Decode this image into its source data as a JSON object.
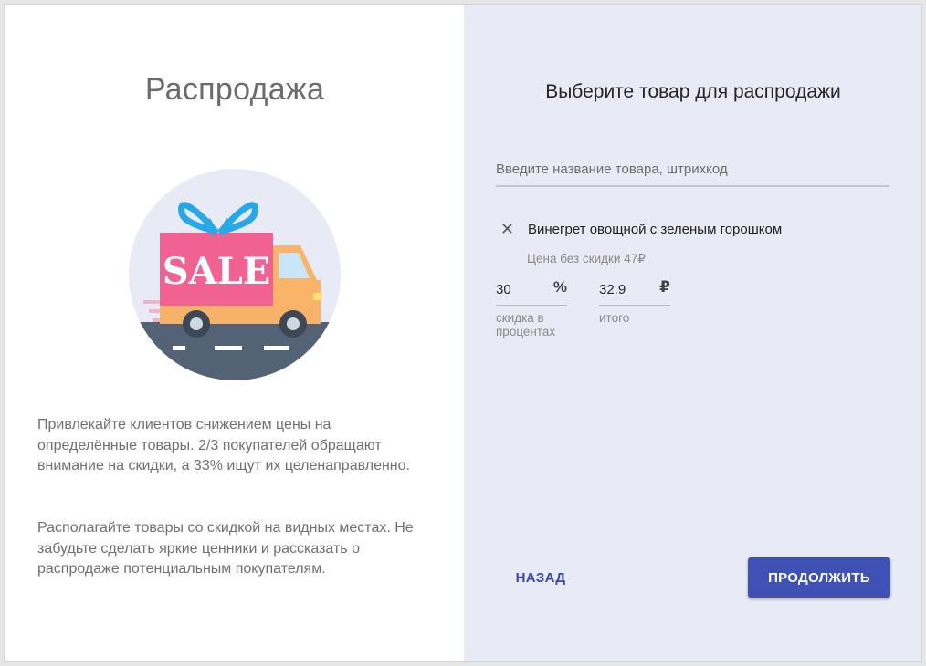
{
  "left": {
    "title": "Распродажа",
    "illustration": {
      "name": "sale-truck-illustration",
      "badge_text": "SALE"
    },
    "paragraph1": "Привлекайте клиентов снижением цены на определённые товары. 2/3 покупателей обращают внимание на скидки, а 33% ищут их целенаправленно.",
    "paragraph2": "Располагайте товары со скидкой на видных местах. Не забудьте сделать яркие ценники и рассказать о распродаже потенциальным покупателям."
  },
  "right": {
    "title": "Выберите товар для распродажи",
    "search": {
      "placeholder": "Введите название товара, штрихкод",
      "value": ""
    },
    "product": {
      "remove_icon": "close-icon",
      "name": "Винегрет овощной с зеленым горошком",
      "price_note": "Цена без скидки 47₽"
    },
    "discount": {
      "value": "30",
      "unit": "%",
      "label": "скидка в процентах"
    },
    "total": {
      "value": "32.9",
      "unit": "₽",
      "label": "итого"
    },
    "buttons": {
      "back": "НАЗАД",
      "next": "ПРОДОЛЖИТЬ"
    }
  },
  "colors": {
    "left_bg": "#ffffff",
    "right_bg": "#e8eaf6",
    "primary": "#3f51b5",
    "link": "#3949ab"
  }
}
